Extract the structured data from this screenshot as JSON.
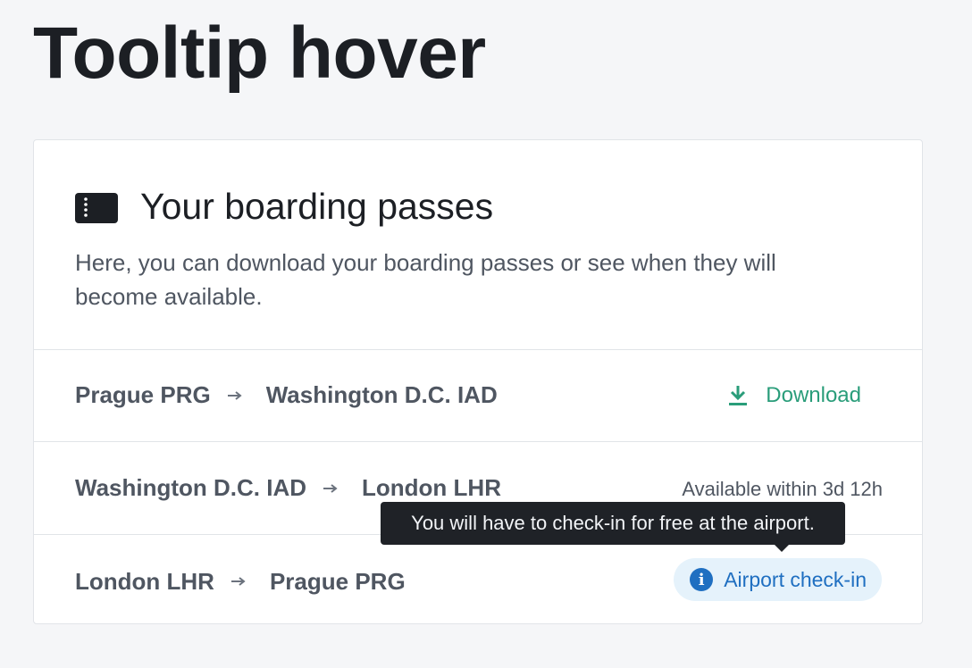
{
  "page": {
    "title": "Tooltip hover"
  },
  "card": {
    "title": "Your boarding passes",
    "description": "Here, you can download your boarding passes or see when they will become available.",
    "icon": "boarding-pass-icon"
  },
  "rows": [
    {
      "from": "Prague PRG",
      "to": "Washington D.C. IAD",
      "action": "Download",
      "action_icon": "download-icon"
    },
    {
      "from": "Washington D.C. IAD",
      "to": "London LHR",
      "status": "Available within 3d 12h"
    },
    {
      "from": "London LHR",
      "to": "Prague PRG",
      "badge": "Airport check-in",
      "badge_icon": "info-icon"
    }
  ],
  "tooltip": {
    "text": "You will have to check-in for free at the airport."
  },
  "colors": {
    "accent_green": "#2a9d7a",
    "info_blue": "#1f6fc1",
    "badge_bg": "#e5f2fb",
    "tooltip_bg": "#1f2227"
  }
}
